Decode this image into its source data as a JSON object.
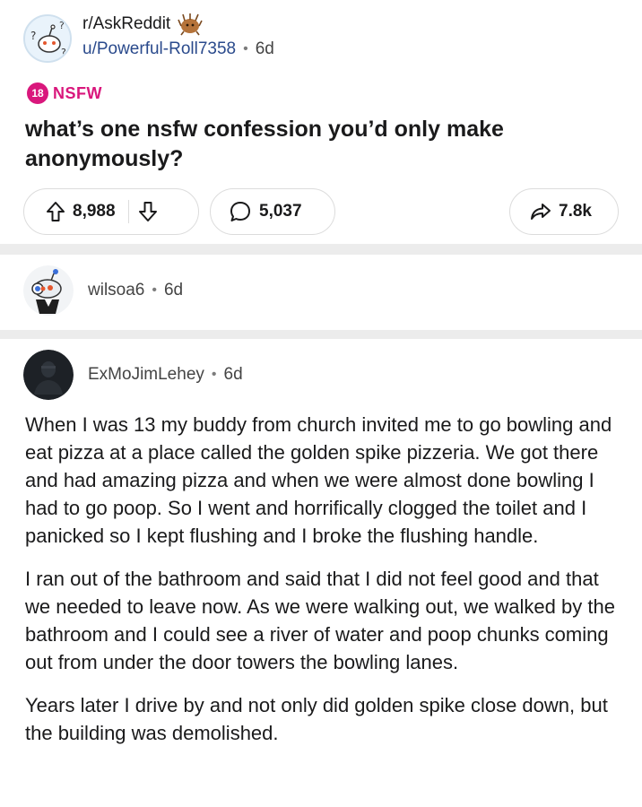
{
  "post": {
    "subreddit": "r/AskReddit",
    "author": "u/Powerful-Roll7358",
    "separator": "•",
    "age": "6d",
    "nsfw_count": "18",
    "nsfw_label": "NSFW",
    "title": "what’s one nsfw confession you’d only make anonymously?",
    "upvotes": "8,988",
    "comments": "5,037",
    "shares": "7.8k"
  },
  "comments": [
    {
      "author": "wilsoa6",
      "separator": "•",
      "age": "6d"
    },
    {
      "author": "ExMoJimLehey",
      "separator": "•",
      "age": "6d",
      "paragraphs": [
        "When I was 13 my buddy from church invited me to go bowling and eat pizza at a place called the golden spike pizzeria. We got there and had amazing pizza and when we were almost done bowling I had to go poop. So I went and horrifically clogged the toilet and I panicked so I kept flushing and I broke the flushing handle.",
        "I ran out of the bathroom and said that I did not feel good and that we needed to leave now. As we were walking out, we walked by the bathroom and I could see a river of water and poop chunks coming out from under the door towers the bowling lanes.",
        "Years later I drive by and not only did golden spike close down, but the building was demolished."
      ]
    }
  ],
  "colors": {
    "nsfw": "#d9177c",
    "username_link": "#2a4a8c",
    "divider": "#ececec"
  }
}
